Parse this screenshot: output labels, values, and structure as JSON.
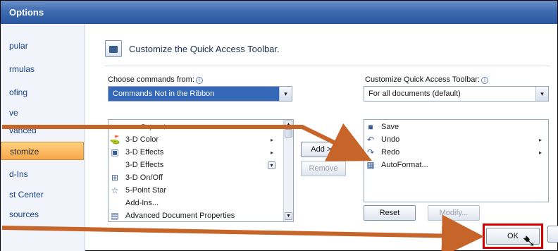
{
  "window": {
    "title": "Options"
  },
  "sidebar": {
    "items": [
      {
        "label": "pular",
        "top": 0
      },
      {
        "label": "rmulas",
        "top": 0
      },
      {
        "label": "ofing",
        "top": 0
      },
      {
        "label": "ve",
        "top": 0
      },
      {
        "label": "vanced",
        "top": 0
      },
      {
        "label": "stomize",
        "top": 0,
        "selected": true
      },
      {
        "label": "d-Ins",
        "top": 0
      },
      {
        "label": "st Center",
        "top": 0
      },
      {
        "label": "sources",
        "top": 0
      }
    ]
  },
  "header": {
    "title": "Customize the Quick Access Toolbar."
  },
  "choose": {
    "label": "Choose commands from:",
    "value": "Commands Not in the Ribbon"
  },
  "qat": {
    "label": "Customize Quick Access Toolbar:",
    "value": "For all documents (default)"
  },
  "command_list": [
    {
      "icon": "separator-icon",
      "glyph": "",
      "label": "<Separator>"
    },
    {
      "icon": "3d-color-icon",
      "glyph": "⛳",
      "label": "3-D Color",
      "submenu": true
    },
    {
      "icon": "3d-effects-icon",
      "glyph": "▣",
      "label": "3-D Effects",
      "submenu": true
    },
    {
      "icon": "3d-effects-dropdown-icon",
      "glyph": "",
      "label": "3-D Effects",
      "dropdown": true
    },
    {
      "icon": "3d-onoff-icon",
      "glyph": "⊞",
      "label": "3-D On/Off"
    },
    {
      "icon": "star-icon",
      "glyph": "☆",
      "label": "5-Point Star"
    },
    {
      "icon": "blank-icon",
      "glyph": "",
      "label": "Add-Ins..."
    },
    {
      "icon": "document-properties-icon",
      "glyph": "▤",
      "label": "Advanced Document Properties"
    }
  ],
  "qat_list": [
    {
      "icon": "save-icon",
      "glyph": "■",
      "label": "Save"
    },
    {
      "icon": "undo-icon",
      "glyph": "↶",
      "label": "Undo",
      "submenu": true
    },
    {
      "icon": "redo-icon",
      "glyph": "↷",
      "label": "Redo",
      "submenu": true
    },
    {
      "icon": "autoformat-icon",
      "glyph": "▦",
      "label": "AutoFormat..."
    }
  ],
  "buttons": {
    "add": "Add >>",
    "remove": "Remove",
    "reset": "Reset",
    "modify": "Modify...",
    "ok": "OK"
  },
  "info_glyph": "i",
  "dropdown_glyph": "▾",
  "submenu_glyph": "▸",
  "colors": {
    "title_blue": "#3e6bb0",
    "selection_orange": "#f7a74a",
    "arrow_orange": "#c7642a",
    "highlight_red": "#d40000"
  }
}
